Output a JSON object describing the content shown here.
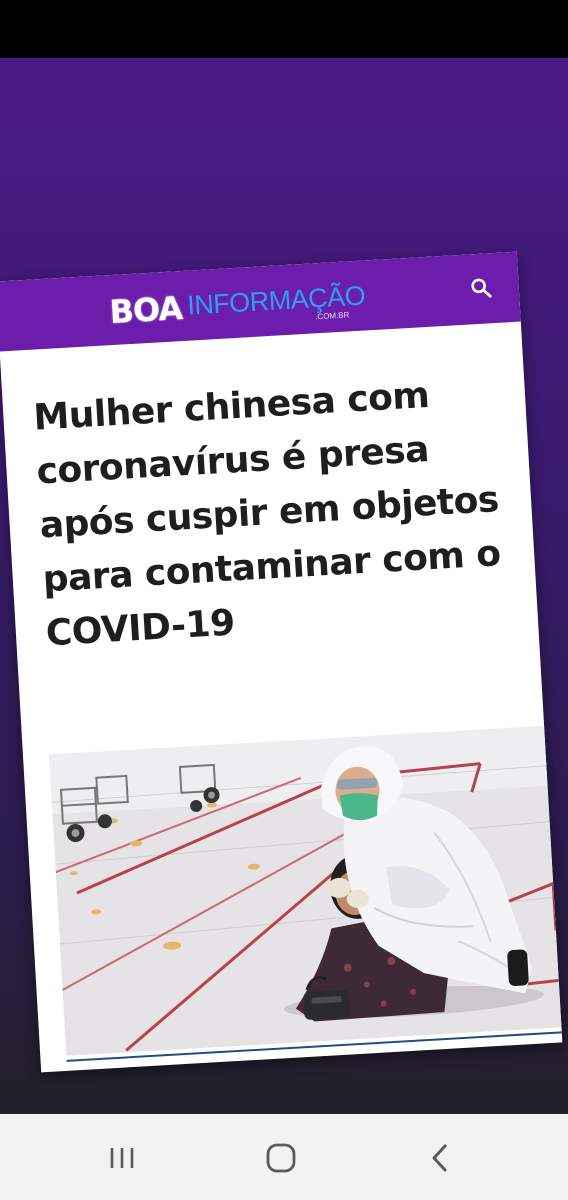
{
  "site": {
    "logo_boa": "BOA",
    "logo_informacao": "INFORMAÇÃO",
    "logo_domain": ".COM.BR",
    "header_color": "#6c1dab",
    "search_icon": "search-icon"
  },
  "article": {
    "headline": "Mulher chinesa com coronavírus é presa após cuspir em objetos para contaminar com o COVID-19"
  },
  "navigation": {
    "recent_apps_icon": "recent-apps-icon",
    "home_icon": "home-icon",
    "back_icon": "back-icon"
  },
  "colors": {
    "background_top": "#4a1a85",
    "background_bottom": "#22202a",
    "headline_text": "#1e1e1e",
    "logo_accent": "#2e9ff0"
  }
}
